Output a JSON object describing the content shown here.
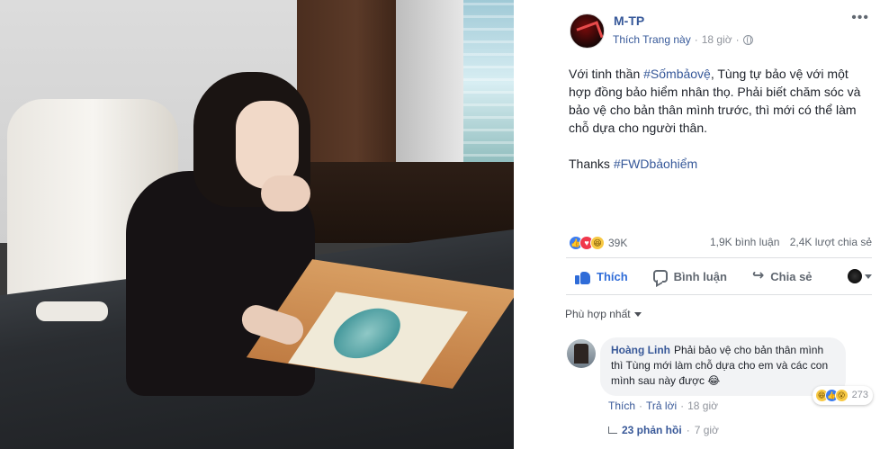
{
  "post": {
    "page_name": "M-TP",
    "like_page": "Thích Trang này",
    "time": "18 giờ",
    "body_prefix": "Với tinh thần ",
    "hashtag_1": "#Sốmbảovệ",
    "body_rest": ", Tùng tự bảo vệ với một hợp đồng bảo hiểm nhân thọ. Phải biết chăm sóc và bảo vệ cho bản thân mình trước, thì mới có thể làm chỗ dựa cho người thân.",
    "thanks_prefix": "Thanks ",
    "hashtag_2": "#FWDbảohiểm"
  },
  "stats": {
    "reaction_count": "39K",
    "comments": "1,9K bình luận",
    "shares": "2,4K lượt chia sẻ"
  },
  "actions": {
    "like": "Thích",
    "comment": "Bình luận",
    "share": "Chia sẻ"
  },
  "comments_section": {
    "sort_label": "Phù hợp nhất",
    "comment": {
      "author": "Hoàng Linh",
      "text": "Phải bảo vệ cho bản thân mình thì Tùng mới làm chỗ dựa cho em và các con mình sau này được 😂",
      "reaction_count": "273",
      "like": "Thích",
      "reply": "Trả lời",
      "time": "18 giờ"
    },
    "replies": {
      "count_label": "23 phản hồi",
      "time": "7 giờ"
    }
  },
  "colors": {
    "link": "#365899",
    "like_active": "#2f6cd8",
    "muted": "#90949c",
    "bubble_bg": "#f2f3f5"
  },
  "icons": [
    "globe-icon",
    "more-icon",
    "thumb-icon",
    "comment-icon",
    "share-icon",
    "caret-icon",
    "reply-arrow-icon"
  ]
}
